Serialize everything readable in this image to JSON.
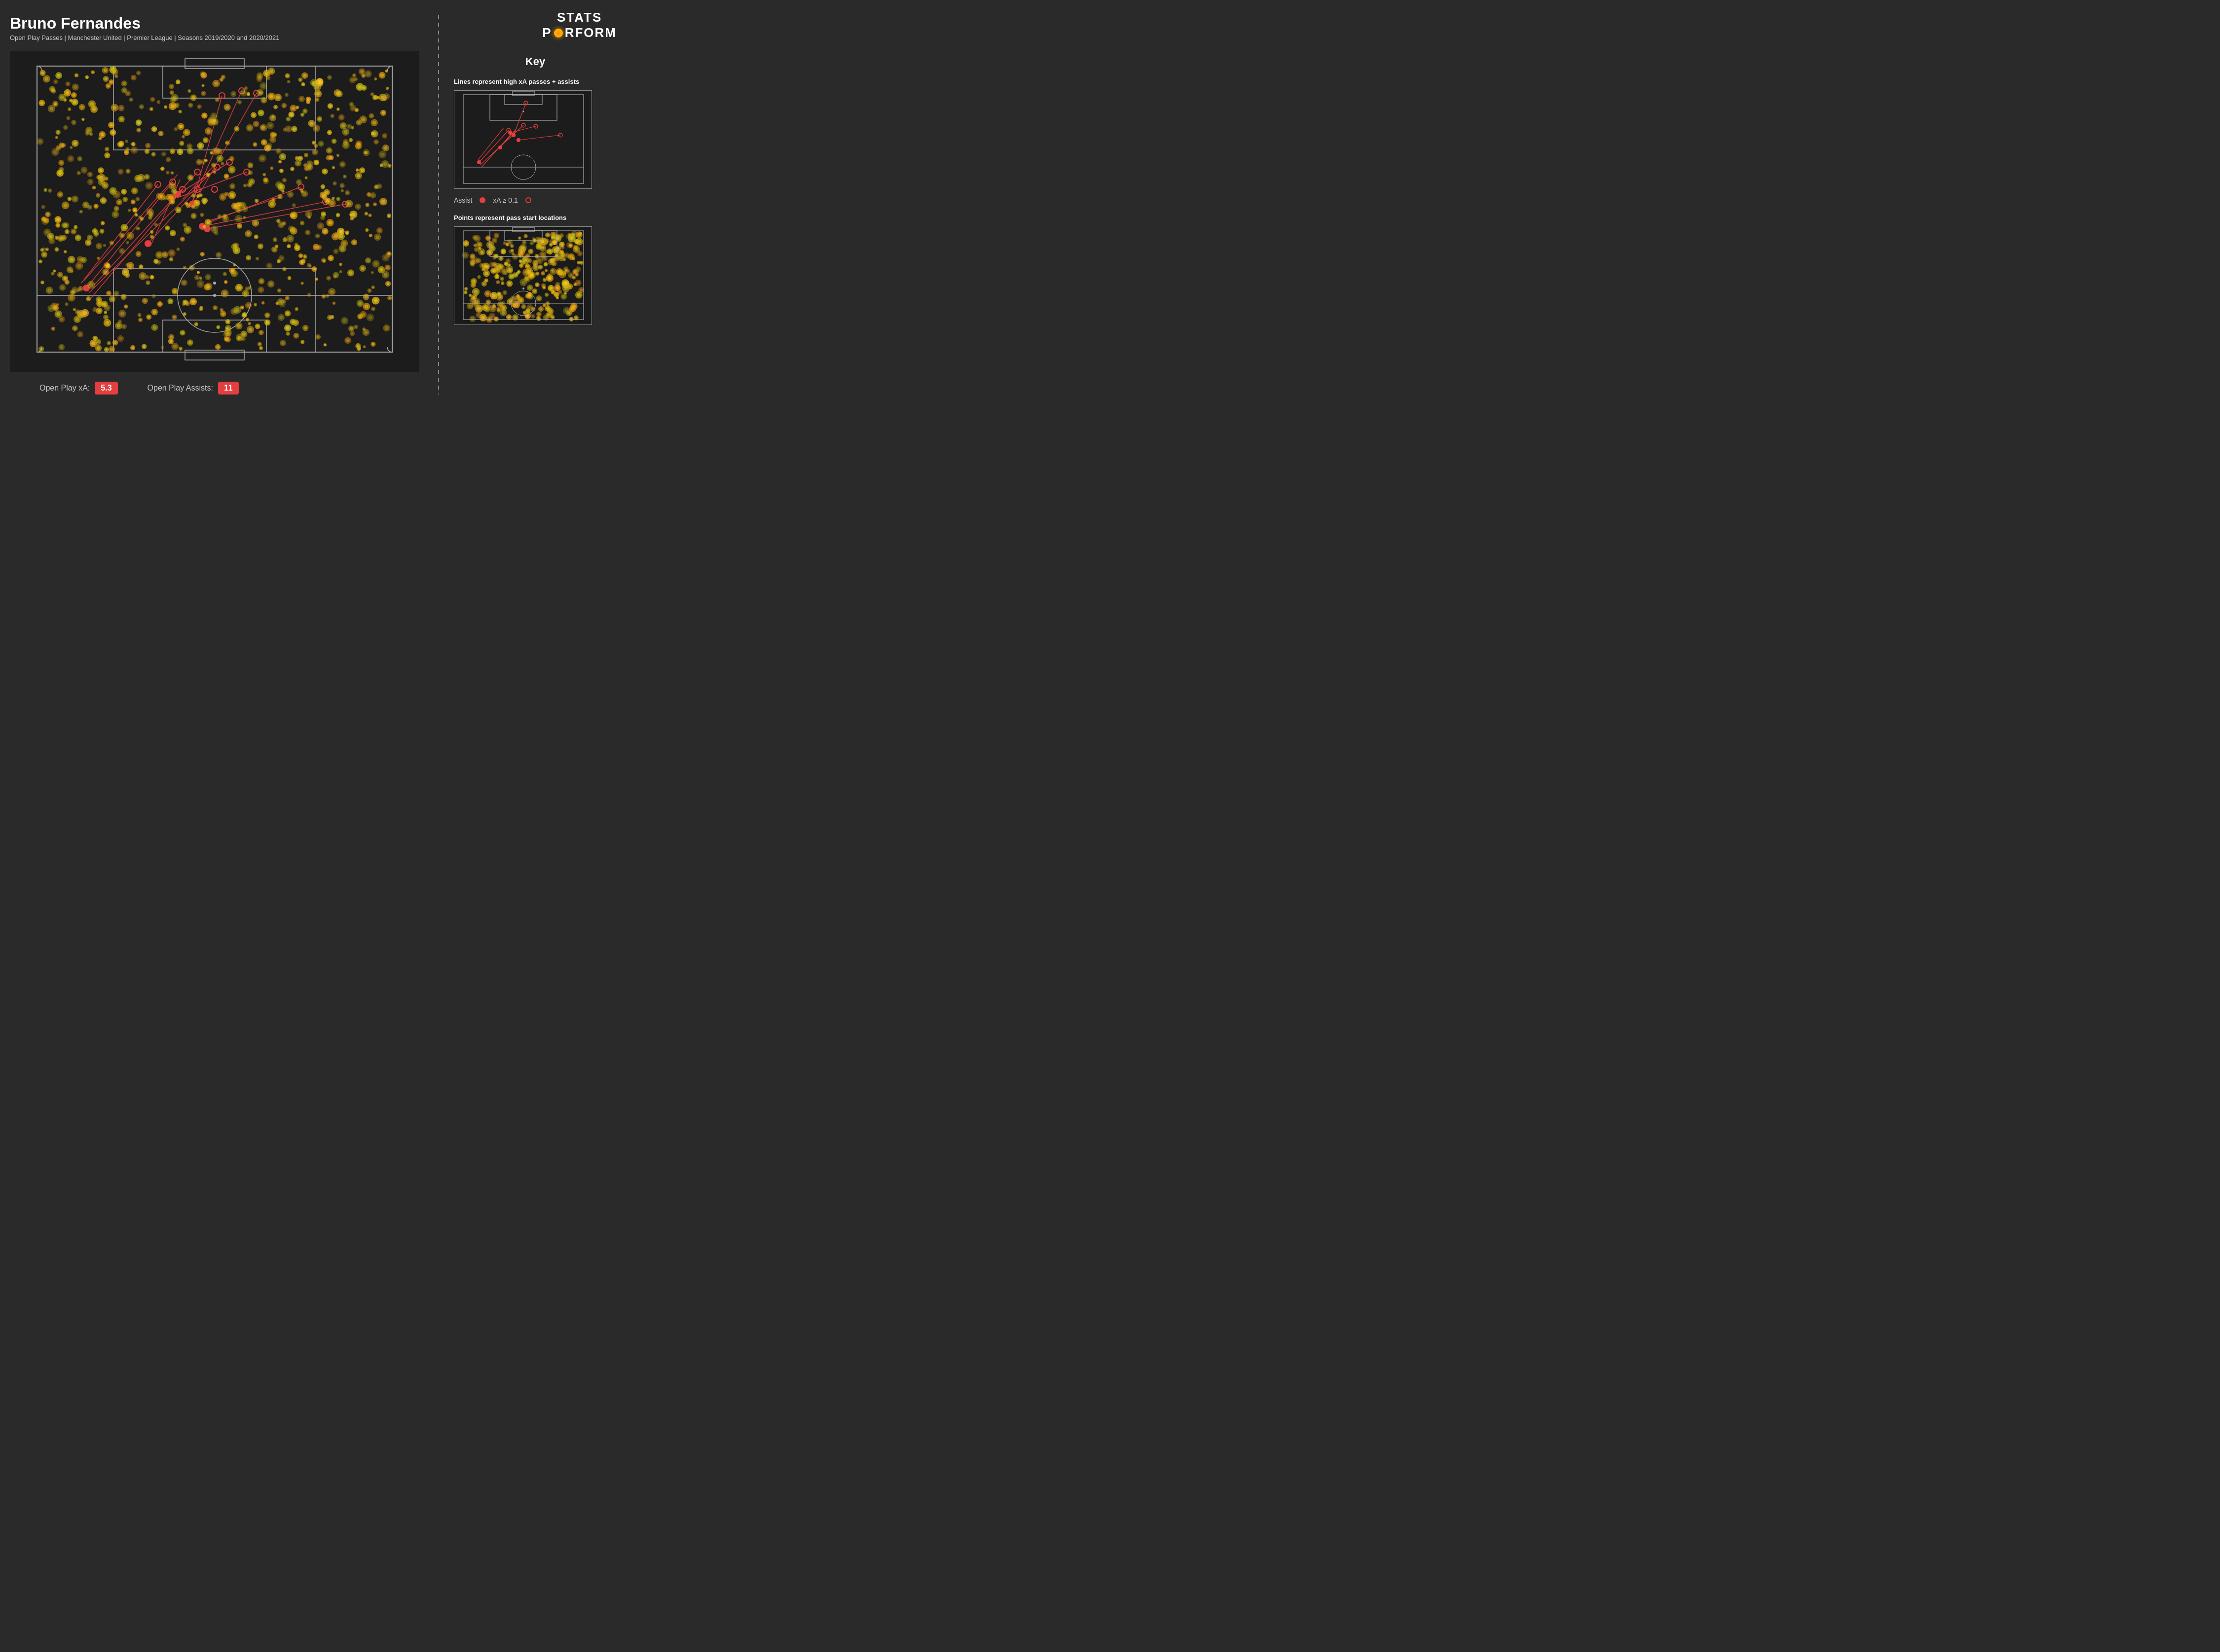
{
  "header": {
    "player_name": "Bruno Fernandes",
    "subtitle": "Open Play Passes | Manchester United | Premier League | Seasons 2019/2020 and 2020/2021"
  },
  "logo": {
    "line1": "STATS",
    "line2": "PERFORM"
  },
  "key": {
    "title": "Key",
    "section1_title": "Lines represent high xA passes + assists",
    "legend_assist": "Assist",
    "legend_xa": "xA ≥ 0.1",
    "section2_title": "Points represent pass start locations"
  },
  "stats": {
    "xa_label": "Open Play xA:",
    "xa_value": "5.3",
    "assists_label": "Open Play Assists:",
    "assists_value": "11"
  }
}
